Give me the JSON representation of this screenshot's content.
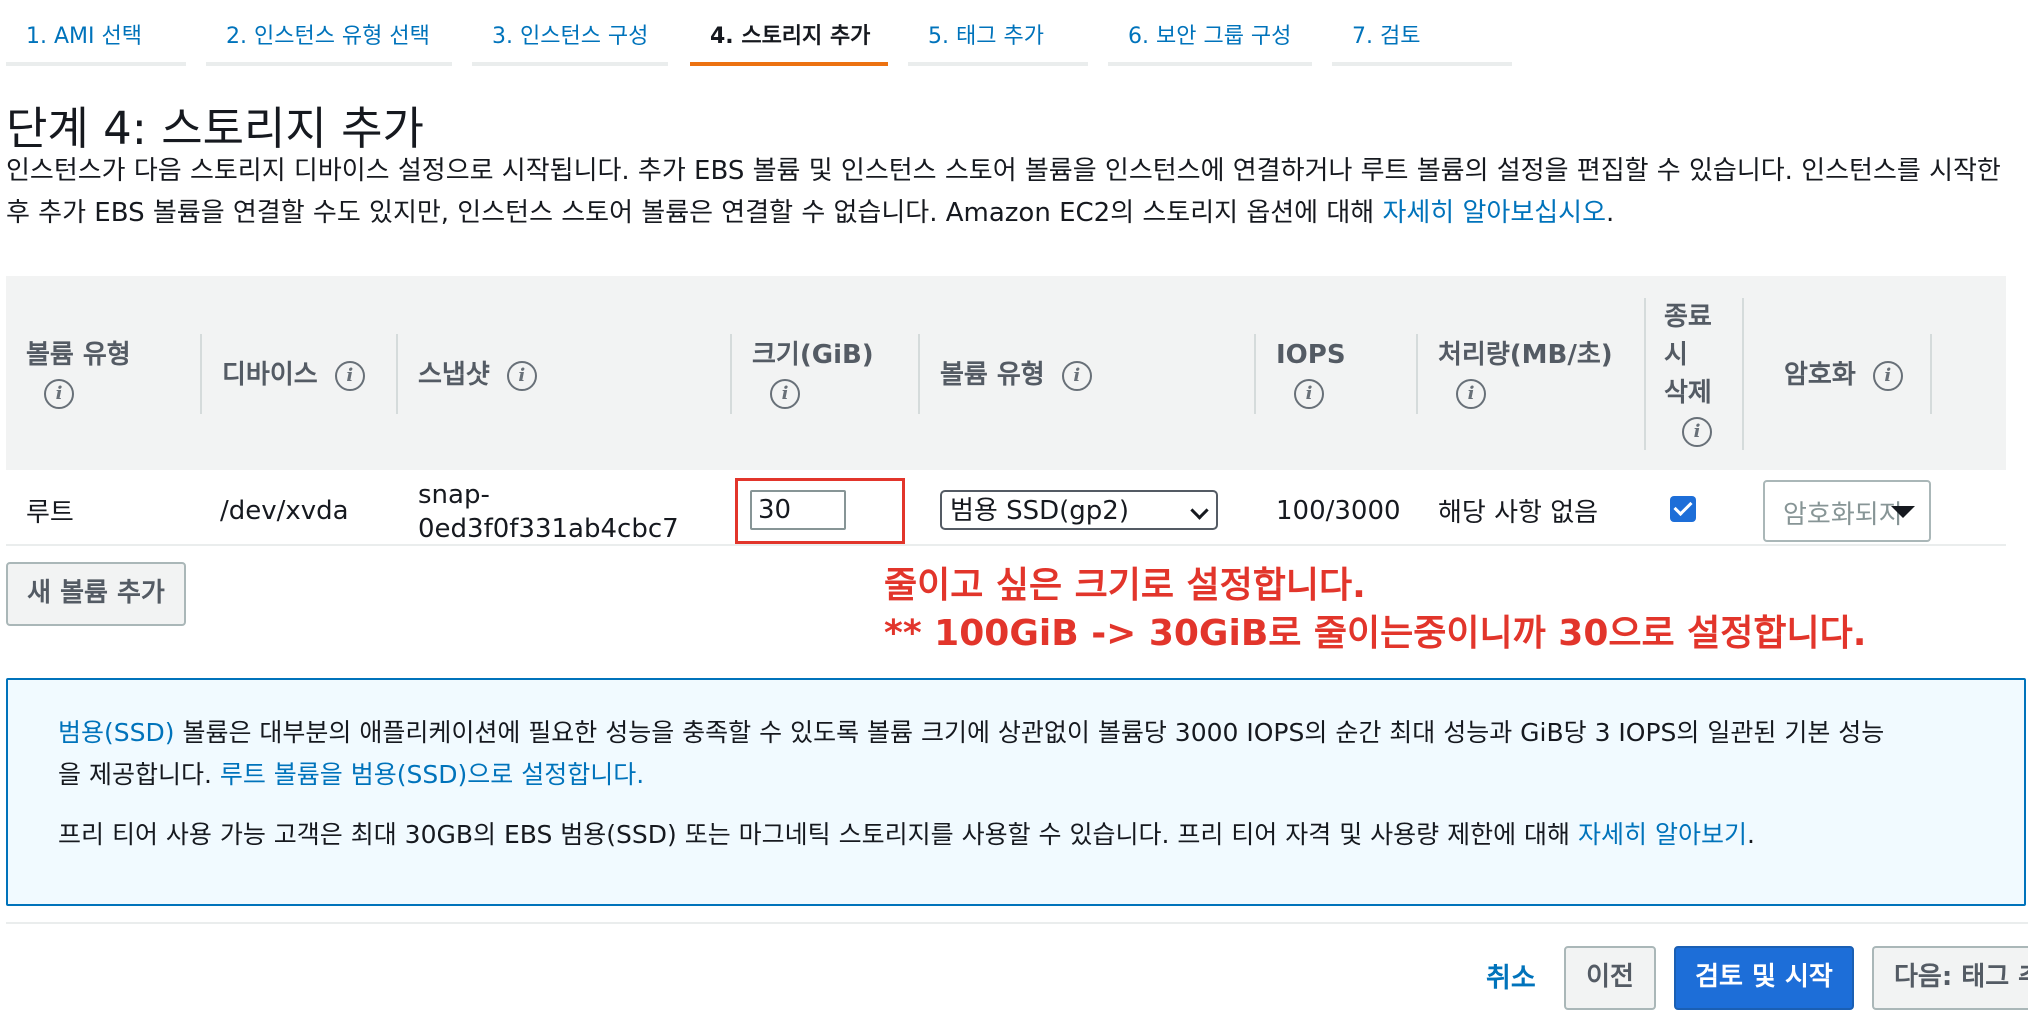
{
  "tabs": [
    {
      "label": "1. AMI 선택"
    },
    {
      "label": "2. 인스턴스 유형 선택"
    },
    {
      "label": "3. 인스턴스 구성"
    },
    {
      "label": "4. 스토리지 추가"
    },
    {
      "label": "5. 태그 추가"
    },
    {
      "label": "6. 보안 그룹 구성"
    },
    {
      "label": "7. 검토"
    }
  ],
  "page": {
    "title": "단계 4: 스토리지 추가",
    "desc_line1": "인스턴스가 다음 스토리지 디바이스 설정으로 시작됩니다. 추가 EBS 볼륨 및 인스턴스 스토어 볼륨을 인스턴스에 연결하거나 루트 볼륨의 설정을 편집할 수 있습니다. 인스턴스를 시작한",
    "desc_line2": "후 추가 EBS 볼륨을 연결할 수도 있지만, 인스턴스 스토어 볼륨은 연결할 수 없습니다. Amazon EC2의 스토리지 옵션에 대해",
    "desc_link": "자세히 알아보십시오",
    "desc_end": "."
  },
  "table": {
    "headers": {
      "volume_type": "볼륨 유형",
      "device": "디바이스",
      "snapshot": "스냅샷",
      "size": "크기(GiB)",
      "volume_kind": "볼륨 유형",
      "iops": "IOPS",
      "throughput": "처리량(MB/초)",
      "delete_l1": "종료",
      "delete_l2": "시",
      "delete_l3": "삭제",
      "encryption": "암호화"
    },
    "info_glyph": "i",
    "row": {
      "volume_type": "루트",
      "device": "/dev/xvda",
      "snapshot_l1": "snap-",
      "snapshot_l2": "0ed3f0f331ab4cbc7",
      "size": "30",
      "volume_kind": "범용 SSD(gp2)",
      "iops": "100/3000",
      "throughput": "해당 사항 없음",
      "delete_on_termination": true,
      "encryption": "암호화되지"
    }
  },
  "add_volume_button": "새 볼륨 추가",
  "annotation": {
    "line1": "줄이고 싶은 크기로 설정합니다.",
    "line2": "** 100GiB -> 30GiB로 줄이는중이니까 30으로 설정합니다."
  },
  "infobox": {
    "p1_link": "범용(SSD)",
    "p1_text": " 볼륨은 대부분의 애플리케이션에 필요한 성능을 충족할 수 있도록 볼륨 크기에 상관없이 볼륨당 3000 IOPS의 순간 최대 성능과 GiB당 3 IOPS의 일관된 기본 성능",
    "p1_text2": "을 제공합니다.",
    "p1_link2": "루트 볼륨을 범용(SSD)으로 설정합니다.",
    "p2_text": "프리 티어 사용 가능 고객은 최대 30GB의 EBS 범용(SSD) 또는 마그네틱 스토리지를 사용할 수 있습니다. 프리 티어 자격 및 사용량 제한에 대해",
    "p2_link": "자세히 알아보기",
    "p2_end": "."
  },
  "footer": {
    "cancel": "취소",
    "previous": "이전",
    "review_launch": "검토 및 시작",
    "next": "다음: 태그 추가"
  },
  "colors": {
    "link": "#0073bb",
    "active_tab": "#ec7211",
    "annotation": "#e2352b",
    "primary_button": "#1d6ed8"
  }
}
